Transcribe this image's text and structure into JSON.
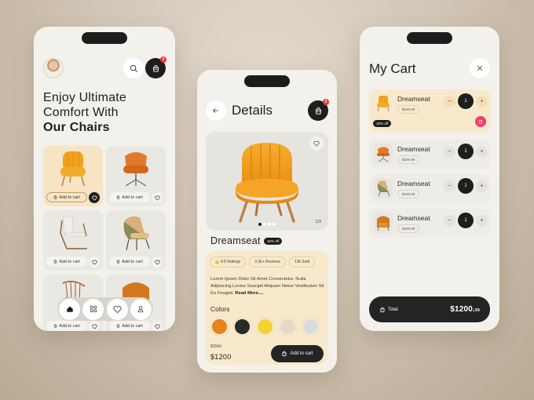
{
  "screen_home": {
    "hero_title_line1": "Enjoy Ultimate",
    "hero_title_line2": "Comfort With",
    "hero_title_bold": "Our Chairs",
    "cart_badge": "2",
    "products": [
      {
        "label": "Add to cart",
        "image": "orange-scalloped-armchair",
        "active": true
      },
      {
        "label": "Add to cart",
        "image": "orange-swivel-chair",
        "active": false
      },
      {
        "label": "Add to cart",
        "image": "white-cantilever-chair",
        "active": false
      },
      {
        "label": "Add to cart",
        "image": "olive-tan-lounge-chair",
        "active": false
      },
      {
        "label": "Add to cart",
        "image": "wooden-spindle-chair",
        "active": false
      },
      {
        "label": "Add to cart",
        "image": "orange-leather-tub-chair",
        "active": false
      }
    ],
    "nav": [
      "home-icon",
      "grid-icon",
      "heart-icon",
      "user-icon"
    ]
  },
  "screen_details": {
    "title": "Details",
    "cart_badge": "2",
    "page_count": "1/3",
    "carousel_total": 4,
    "carousel_index": 1,
    "product_name": "Dreamseat",
    "discount": "15% off",
    "stats": {
      "ratings": "4.8 Ratings",
      "reviews": "3.2k+ Reviews",
      "sold": "13k Sold"
    },
    "description": "Lorem Ipsum Dolor Sit Amet Consectetur. Nulla Adipiscing Lectus Suscipit Aliquam Netus Vestibulum Sit Eu Feugiat.",
    "read_more": "Read More....",
    "colors_label": "Colors",
    "colors": [
      "#e8821a",
      "#2a2a2a",
      "#f1d332",
      "#e7d8c5",
      "#dadbdd"
    ],
    "old_price": "$1564",
    "price": "$1200",
    "add_to_cart": "Add to cart"
  },
  "screen_cart": {
    "title": "My Cart",
    "items": [
      {
        "name": "Dreamseat",
        "price": "$249.69",
        "qty": "1",
        "discount": "15% off",
        "image": "orange-scalloped-armchair"
      },
      {
        "name": "Dreamseat",
        "price": "$249.69",
        "qty": "1",
        "image": "orange-swivel-chair"
      },
      {
        "name": "Dreamseat",
        "price": "$249.69",
        "qty": "1",
        "image": "olive-tan-lounge-chair"
      },
      {
        "name": "Dreamseat",
        "price": "$249.69",
        "qty": "1",
        "image": "orange-leather-tub-chair"
      }
    ],
    "minus": "−",
    "plus": "+",
    "total_label": "Total",
    "total_amount": "$1200.",
    "total_cents": "99"
  },
  "colors": {
    "accent_cream": "#f8e9cc",
    "dark": "#1e1e1e",
    "badge_red": "#e5322f",
    "delete_pink": "#ef3f6c",
    "screen_bg": "#f3f1ec"
  }
}
